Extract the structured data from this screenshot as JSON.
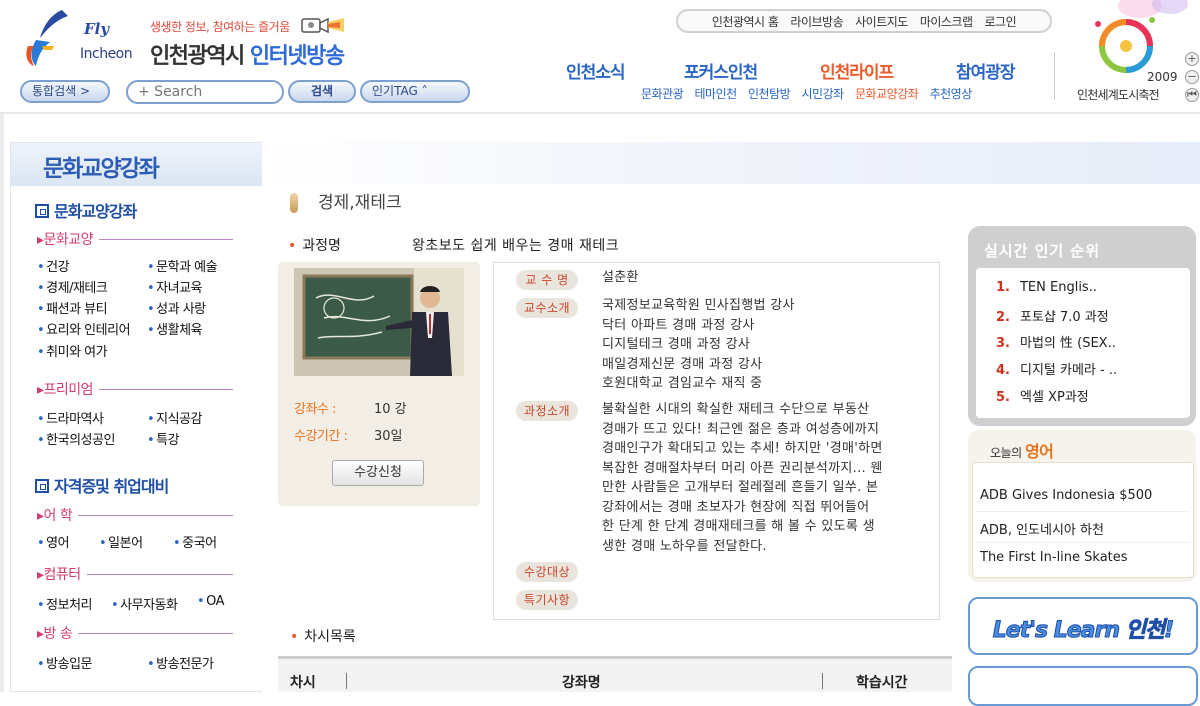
{
  "header": {
    "logo_fly": "Fly",
    "logo_incheon": "Incheon",
    "tagline": "생생한 정보, 참여하는 즐거움",
    "site_title_black": "인천광역시",
    "site_title_blue": "인터넷방송",
    "integrated_search_label": "통합검색 >",
    "search_placeholder": "+ Search",
    "search_button": "검색",
    "tag_button": "인기TAG ˄",
    "util_links": [
      "인천광역시 홈",
      "라이브방송",
      "사이트지도",
      "마이스크랩",
      "로그인"
    ],
    "gnb_main": [
      "인천소식",
      "포커스인천",
      "인천라이프",
      "참여광장"
    ],
    "gnb_sub": [
      "문화관광",
      "테마인천",
      "인천탐방",
      "시민강좌",
      "문화교양강좌",
      "추천영상"
    ],
    "expo_year": "2009",
    "expo_name": "인천세계도시축전",
    "zoom_in": "+",
    "zoom_out": "−",
    "zoom_reset": "⏮"
  },
  "sidebar": {
    "title": "문화교양강좌",
    "section1": "문화교양강좌",
    "cat_culture": "▸문화교양",
    "culture_items": [
      "건강",
      "문학과 예술",
      "경제/재테크",
      "자녀교육",
      "패션과 뷰티",
      "성과 사랑",
      "요리와 인테리어",
      "생활체육",
      "취미와 여가"
    ],
    "cat_premium": "▸프리미엄",
    "premium_items": [
      "드라마역사",
      "지식공감",
      "한국의성공인",
      "특강"
    ],
    "section2": "자격증및 취업대비",
    "cat_language": "▸어 학",
    "language_items": [
      "영어",
      "일본어",
      "중국어"
    ],
    "cat_computer": "▸컴퓨터",
    "computer_items": [
      "정보처리",
      "사무자동화",
      "OA"
    ],
    "cat_broadcast": "▸방 송",
    "broadcast_items": [
      "방송입문",
      "방송전문가"
    ]
  },
  "content": {
    "page_title": "경제,재테크",
    "course_label": "과정명",
    "course_name": "왕초보도 쉽게 배우는 경매 재테크",
    "lectures_label": "강좌수 :",
    "lectures_value": "10 강",
    "period_label": "수강기간 :",
    "period_value": "30일",
    "enroll_button": "수강신청",
    "tag_professor": "교 수 명",
    "professor_name": "설춘환",
    "tag_intro": "교수소개",
    "intro_lines": [
      "국제정보교육학원 민사집행법 강사",
      "닥터 아파트 경매 과정 강사",
      "디지털테크 경매 과정 강사",
      "매일경제신문 경매 과정 강사",
      "호원대학교 겸임교수 재직 중"
    ],
    "tag_course_intro": "과정소개",
    "course_intro_lines": [
      "불확실한 시대의 확실한 재테크 수단으로 부동산",
      "경매가 뜨고 있다! 최근엔 젊은 층과 여성층에까지",
      "경매인구가 확대되고 있는 추세! 하지만 '경매'하면",
      "복잡한 경매절차부터 머리 아픈 권리분석까지... 웬",
      "만한 사람들은 고개부터 절레절레 흔들기 일쑤. 본",
      "강좌에서는 경매 초보자가 현장에 직접 뛰어들어",
      "한 단계 한 단계 경매재테크를 해 볼 수 있도록 생",
      "생한 경매 노하우를 전달한다."
    ],
    "tag_target": "수강대상",
    "tag_special": "특기사항",
    "chasi_title": "차시목록",
    "table_headers": [
      "차시",
      "강좌명",
      "학습시간"
    ]
  },
  "right": {
    "rank_title": "실시간 인기 순위",
    "rank_items": [
      {
        "num": "1.",
        "text": "TEN Englis.."
      },
      {
        "num": "2.",
        "text": "포토샵 7.0 과정"
      },
      {
        "num": "3.",
        "text": "마법의 性 (SEX.."
      },
      {
        "num": "4.",
        "text": "디지털 카메라 - .."
      },
      {
        "num": "5.",
        "text": "엑셀 XP과정"
      }
    ],
    "eng_title_small": "오늘의",
    "eng_title_big": "영어",
    "eng_items": [
      "ADB Gives Indonesia $500",
      "ADB, 인도네시아 하천",
      "The First In-line Skates"
    ],
    "lets_learn": "Let's Learn 인천!"
  },
  "colors": {
    "brand_blue": "#2a66c6",
    "active_orange": "#ee5a2a",
    "category_pink": "#d43c6a"
  }
}
